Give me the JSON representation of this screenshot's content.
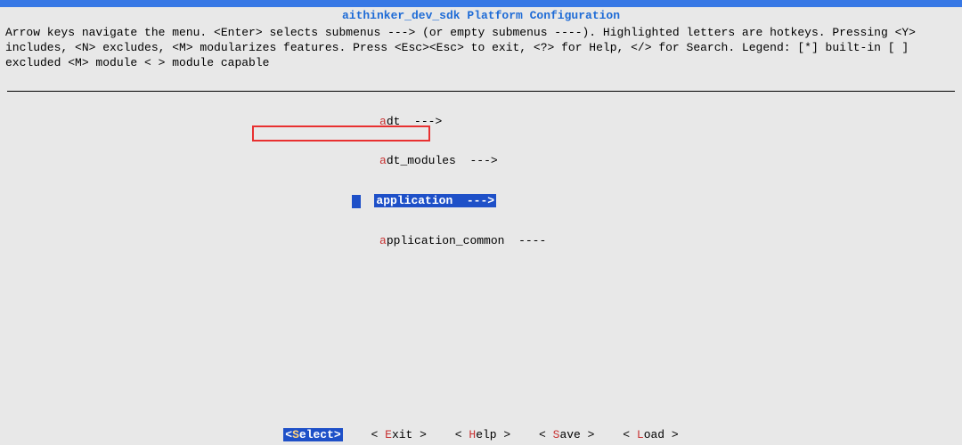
{
  "title": "aithinker_dev_sdk Platform Configuration",
  "help_text": "Arrow keys navigate the menu.  <Enter> selects submenus ---> (or empty submenus ----).  Highlighted letters are hotkeys.  Pressing <Y> includes, <N> excludes, <M> modularizes features.  Press <Esc><Esc> to exit, <?> for Help, </> for Search.  Legend: [*] built-in  [ ] excluded  <M> module  < > module capable",
  "menu": {
    "items": [
      {
        "hotkey": "a",
        "label": "dt",
        "suffix": "  --->",
        "selected": false
      },
      {
        "hotkey": "a",
        "label": "dt_modules",
        "suffix": "  --->",
        "selected": false
      },
      {
        "hotkey": "a",
        "label": "pplication",
        "suffix": "  --->",
        "selected": true
      },
      {
        "hotkey": "a",
        "label": "pplication_common",
        "suffix": "  ----",
        "selected": false
      }
    ]
  },
  "buttons": [
    {
      "label_pre": "<",
      "hotkey": "S",
      "label_post": "elect>",
      "selected": true
    },
    {
      "label_pre": "< ",
      "hotkey": "E",
      "label_post": "xit >",
      "selected": false
    },
    {
      "label_pre": "< ",
      "hotkey": "H",
      "label_post": "elp >",
      "selected": false
    },
    {
      "label_pre": "< ",
      "hotkey": "S",
      "label_post": "ave >",
      "selected": false
    },
    {
      "label_pre": "< ",
      "hotkey": "L",
      "label_post": "oad >",
      "selected": false
    }
  ]
}
